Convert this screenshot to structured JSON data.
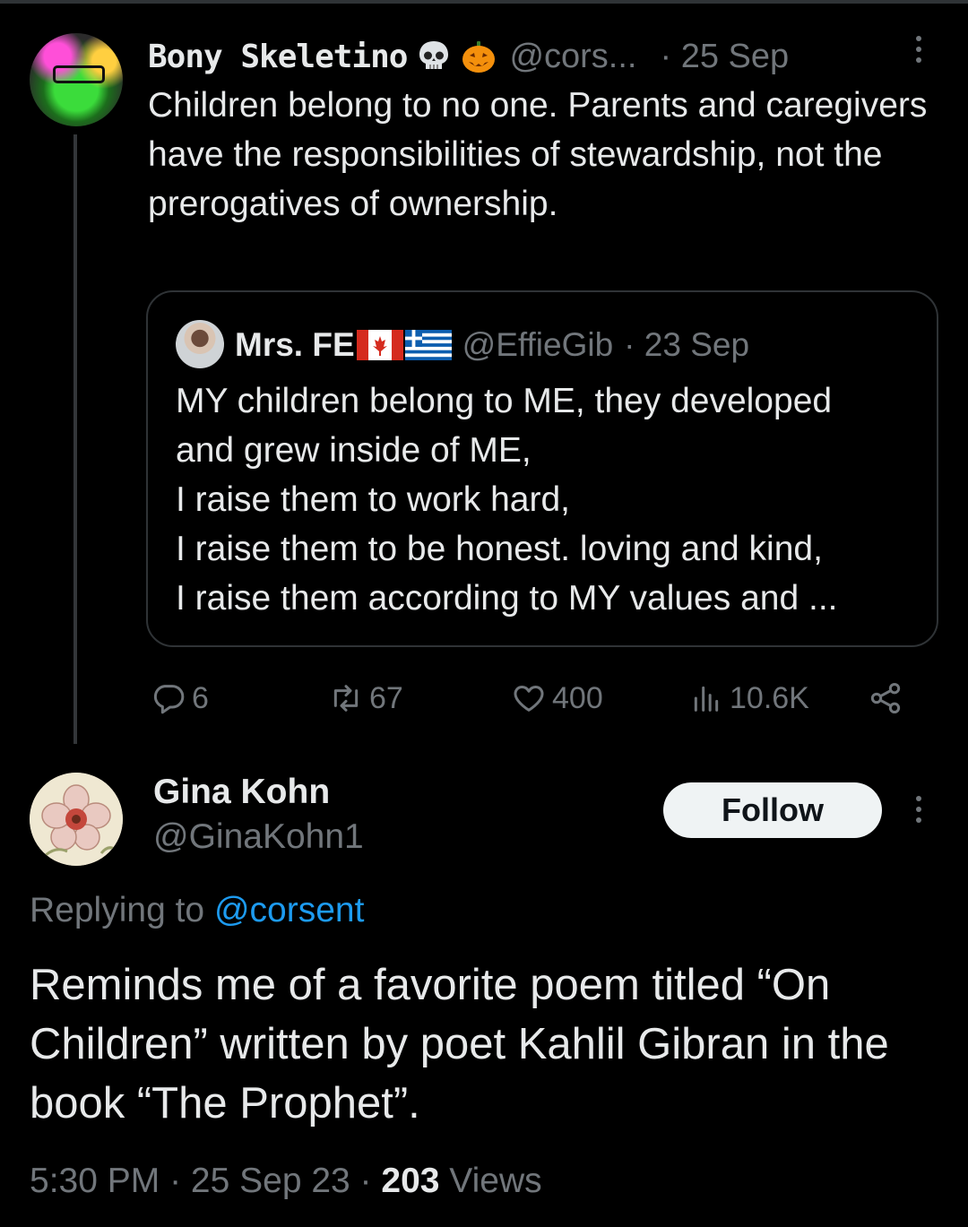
{
  "parent": {
    "name": "Bony Skeletino",
    "handle": "@cors...",
    "date": "· 25 Sep",
    "text": "Children belong to no one. Parents and caregivers have the responsibilities of stewardship, not the prerogatives of ownership.",
    "quote": {
      "name": "Mrs. FE",
      "handle": "@EffieGib",
      "date": "· 23 Sep",
      "lines": [
        "MY children belong to ME, they developed",
        "and grew inside of ME,",
        "I raise them to work hard,",
        "I raise them to be honest. loving and kind,",
        "I raise them according to MY values and ..."
      ]
    },
    "stats": {
      "replies": "6",
      "reposts": "67",
      "likes": "400",
      "views": "10.6K"
    }
  },
  "reply": {
    "name": "Gina Kohn",
    "handle": "@GinaKohn1",
    "follow_label": "Follow",
    "replying_prefix": "Replying to",
    "replying_to": "@corsent",
    "text": "Reminds me of a favorite poem titled “On Children” written by poet Kahlil Gibran in the book “The Prophet”.",
    "time": "5:30 PM · 25 Sep 23 · ",
    "views_count": "203",
    "views_label": " Views"
  },
  "icons": {
    "more": "more-dots-icon",
    "reply": "reply-bubble-icon",
    "repost": "repost-icon",
    "like": "heart-icon",
    "views": "bar-chart-icon",
    "share": "share-icon"
  },
  "colors": {
    "background": "#000000",
    "text": "#e7e9ea",
    "muted": "#71767b",
    "link": "#1d9bf0",
    "border": "#2f3336"
  }
}
